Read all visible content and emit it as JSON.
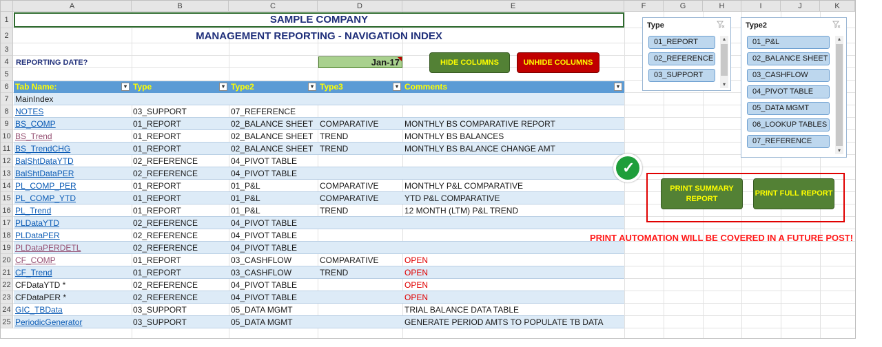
{
  "columns": [
    "A",
    "B",
    "C",
    "D",
    "E",
    "F",
    "G",
    "H",
    "I",
    "J",
    "K"
  ],
  "rows": [
    "1",
    "2",
    "3",
    "4",
    "5",
    "6",
    "7",
    "8",
    "9",
    "10",
    "11",
    "12",
    "13",
    "14",
    "15",
    "16",
    "17",
    "18",
    "19",
    "20",
    "21",
    "22",
    "23",
    "24",
    "25"
  ],
  "title": "SAMPLE COMPANY",
  "subtitle": "MANAGEMENT REPORTING - NAVIGATION INDEX",
  "reporting_label": "REPORTING DATE?",
  "reporting_date": "Jan-17",
  "buttons": {
    "hide": "HIDE COLUMNS",
    "unhide": "UNHIDE COLUMNS",
    "print_summary": "PRINT SUMMARY REPORT",
    "print_full": "PRINT FULL REPORT"
  },
  "table_headers": [
    "Tab Name:",
    "Type",
    "Type2",
    "Type3",
    "Comments"
  ],
  "table_rows": [
    {
      "name": "MainIndex",
      "type": "",
      "type2": "",
      "type3": "",
      "comment": "",
      "style": "plain"
    },
    {
      "name": "NOTES",
      "type": "03_SUPPORT",
      "type2": "07_REFERENCE",
      "type3": "",
      "comment": "",
      "style": "link"
    },
    {
      "name": "BS_COMP",
      "type": "01_REPORT",
      "type2": "02_BALANCE SHEET",
      "type3": "COMPARATIVE",
      "comment": "MONTHLY BS COMPARATIVE REPORT",
      "style": "link"
    },
    {
      "name": "BS_Trend",
      "type": "01_REPORT",
      "type2": "02_BALANCE SHEET",
      "type3": "TREND",
      "comment": "MONTHLY BS BALANCES",
      "style": "visited"
    },
    {
      "name": "BS_TrendCHG",
      "type": "01_REPORT",
      "type2": "02_BALANCE SHEET",
      "type3": "TREND",
      "comment": "MONTHLY BS BALANCE CHANGE AMT",
      "style": "link"
    },
    {
      "name": "BalShtDataYTD",
      "type": "02_REFERENCE",
      "type2": "04_PIVOT TABLE",
      "type3": "",
      "comment": "",
      "style": "link"
    },
    {
      "name": "BalShtDataPER",
      "type": "02_REFERENCE",
      "type2": "04_PIVOT TABLE",
      "type3": "",
      "comment": "",
      "style": "link"
    },
    {
      "name": "PL_COMP_PER",
      "type": "01_REPORT",
      "type2": "01_P&L",
      "type3": "COMPARATIVE",
      "comment": "MONTHLY P&L COMPARATIVE",
      "style": "link"
    },
    {
      "name": "PL_COMP_YTD",
      "type": "01_REPORT",
      "type2": "01_P&L",
      "type3": "COMPARATIVE",
      "comment": "YTD P&L COMPARATIVE",
      "style": "link"
    },
    {
      "name": "PL_Trend",
      "type": "01_REPORT",
      "type2": "01_P&L",
      "type3": "TREND",
      "comment": "12 MONTH (LTM) P&L TREND",
      "style": "link"
    },
    {
      "name": "PLDataYTD",
      "type": "02_REFERENCE",
      "type2": "04_PIVOT TABLE",
      "type3": "",
      "comment": "",
      "style": "link"
    },
    {
      "name": "PLDataPER",
      "type": "02_REFERENCE",
      "type2": "04_PIVOT TABLE",
      "type3": "",
      "comment": "",
      "style": "link"
    },
    {
      "name": "PLDataPERDETL",
      "type": "02_REFERENCE",
      "type2": "04_PIVOT TABLE",
      "type3": "",
      "comment": "",
      "style": "visited"
    },
    {
      "name": "CF_COMP",
      "type": "01_REPORT",
      "type2": "03_CASHFLOW",
      "type3": "COMPARATIVE",
      "comment": "OPEN",
      "style": "visited"
    },
    {
      "name": "CF_Trend",
      "type": "01_REPORT",
      "type2": "03_CASHFLOW",
      "type3": "TREND",
      "comment": "OPEN",
      "style": "link"
    },
    {
      "name": "CFDataYTD *",
      "type": "02_REFERENCE",
      "type2": "04_PIVOT TABLE",
      "type3": "",
      "comment": "OPEN",
      "style": "plain"
    },
    {
      "name": "CFDataPER *",
      "type": "02_REFERENCE",
      "type2": "04_PIVOT TABLE",
      "type3": "",
      "comment": "OPEN",
      "style": "plain"
    },
    {
      "name": "GIC_TBData",
      "type": "03_SUPPORT",
      "type2": "05_DATA MGMT",
      "type3": "",
      "comment": "TRIAL BALANCE DATA TABLE",
      "style": "link"
    },
    {
      "name": "PeriodicGenerator",
      "type": "03_SUPPORT",
      "type2": "05_DATA MGMT",
      "type3": "",
      "comment": "GENERATE PERIOD AMTS TO POPULATE TB DATA",
      "style": "link"
    }
  ],
  "slicer_type": {
    "title": "Type",
    "items": [
      "01_REPORT",
      "02_REFERENCE",
      "03_SUPPORT"
    ]
  },
  "slicer_type2": {
    "title": "Type2",
    "items": [
      "01_P&L",
      "02_BALANCE SHEET",
      "03_CASHFLOW",
      "04_PIVOT TABLE",
      "05_DATA MGMT",
      "06_LOOKUP TABLES",
      "07_REFERENCE"
    ]
  },
  "note": "PRINT AUTOMATION WILL BE COVERED IN A FUTURE POST!",
  "icons": {
    "check": "check-circle-icon",
    "filter": "filter-dropdown-icon",
    "clear_filter": "clear-filter-icon"
  },
  "colors": {
    "header_blue": "#5b9bd5",
    "band": "#ddebf7",
    "green_btn": "#538135",
    "red_btn": "#c00000",
    "link": "#0b5bb5",
    "open": "#e00000"
  }
}
